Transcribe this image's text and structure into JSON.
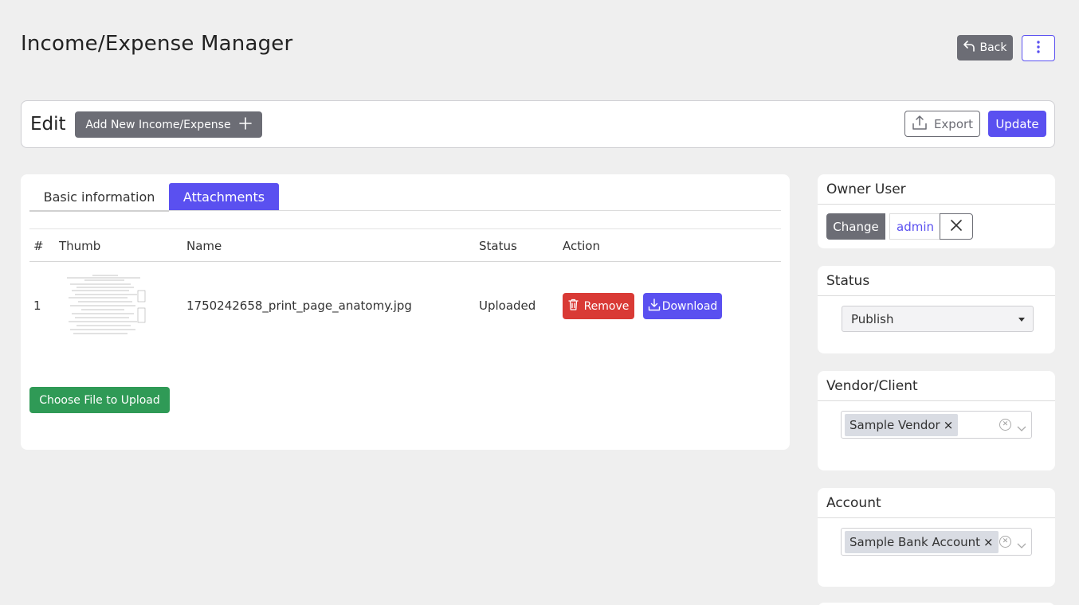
{
  "header": {
    "title": "Income/Expense Manager",
    "back_label": "Back"
  },
  "toolbar": {
    "edit_label": "Edit",
    "add_label": "Add New Income/Expense",
    "export_label": "Export",
    "update_label": "Update"
  },
  "tabs": [
    {
      "label": "Basic information"
    },
    {
      "label": "Attachments"
    }
  ],
  "attachments": {
    "columns": [
      "#",
      "Thumb",
      "Name",
      "Status",
      "Action"
    ],
    "rows": [
      {
        "index": "1",
        "name": "1750242658_print_page_anatomy.jpg",
        "status": "Uploaded"
      }
    ],
    "remove_label": "Remove",
    "download_label": "Download",
    "upload_label": "Choose File to Upload"
  },
  "sidebar": {
    "owner": {
      "title": "Owner User",
      "change_label": "Change",
      "user": "admin"
    },
    "status": {
      "title": "Status",
      "selected": "Publish"
    },
    "vendor": {
      "title": "Vendor/Client",
      "selected": "Sample Vendor"
    },
    "account": {
      "title": "Account",
      "selected": "Sample Bank Account"
    }
  },
  "colors": {
    "primary": "#5a50f0",
    "secondary": "#6c6d75",
    "danger": "#d93a35",
    "success": "#2f9a56",
    "background": "#efefef"
  },
  "icons": [
    "back-arrow-icon",
    "kebab-menu-icon",
    "plus-icon",
    "export-icon",
    "trash-icon",
    "download-icon",
    "close-icon",
    "caret-down-icon",
    "clear-circle-icon",
    "chevron-down-icon"
  ]
}
